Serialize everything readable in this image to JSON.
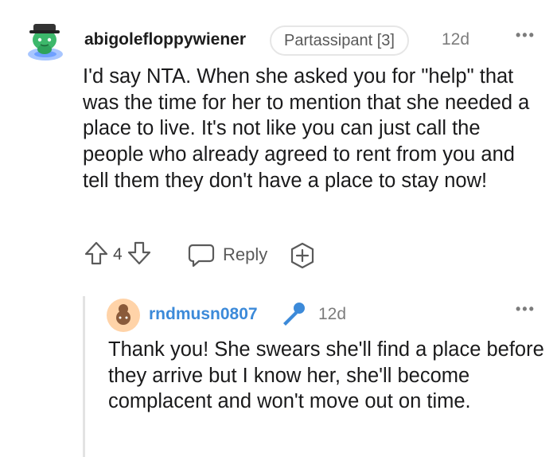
{
  "comment": {
    "username": "abigolefloppywiener",
    "flair": "Partassipant [3]",
    "timestamp": "12d",
    "more_label": "•••",
    "body": "I'd say NTA. When she asked you for \"help\" that was the time for her to mention that she needed a place to live. It's not like you can just call the people who already agreed to rent from you and tell them they don't have a place to stay now!",
    "vote_count": "4",
    "reply_label": "Reply",
    "avatar_icon": "snoo-avatar-icon",
    "upvote_icon": "upvote-arrow-icon",
    "downvote_icon": "downvote-arrow-icon",
    "reply_icon": "speech-bubble-icon",
    "award_icon": "award-plus-icon"
  },
  "reply": {
    "username": "rndmusn0807",
    "timestamp": "12d",
    "more_label": "•••",
    "body": "Thank you! She swears she'll find a place before they arrive but I know her, she'll become complacent and won't move out on time.",
    "badge_icon": "microphone-icon",
    "username_color": "#3c8ad9"
  }
}
